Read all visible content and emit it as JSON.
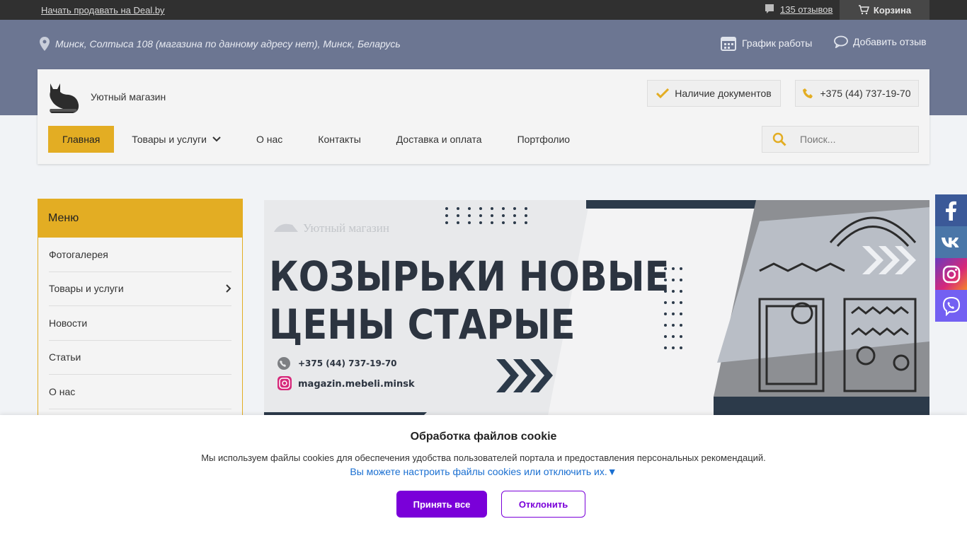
{
  "topbar": {
    "sell_link": "Начать продавать на Deal.by",
    "reviews": "135 отзывов",
    "cart": "Корзина"
  },
  "band": {
    "address": "Минск, Солтыса 108 (магазина по данному адресу нет), Минск, Беларусь",
    "schedule": "График работы",
    "add_review": "Добавить отзыв"
  },
  "header": {
    "shop_name": "Уютный магазин",
    "docs": "Наличие документов",
    "phone": "+375 (44) 737-19-70",
    "search_placeholder": "Поиск..."
  },
  "nav": {
    "items": [
      {
        "label": "Главная"
      },
      {
        "label": "Товары и услуги"
      },
      {
        "label": "О нас"
      },
      {
        "label": "Контакты"
      },
      {
        "label": "Доставка и оплата"
      },
      {
        "label": "Портфолио"
      }
    ]
  },
  "sidebar": {
    "title": "Меню",
    "items": [
      {
        "label": "Фотогалерея"
      },
      {
        "label": "Товары и услуги"
      },
      {
        "label": "Новости"
      },
      {
        "label": "Статьи"
      },
      {
        "label": "О нас"
      }
    ]
  },
  "banner": {
    "watermark": "Уютный магазин",
    "headline_1": "КОЗЫРЬКИ НОВЫЕ",
    "headline_2": "ЦЕНЫ СТАРЫЕ",
    "phone": "+375 (44) 737-19-70",
    "instagram": "magazin.mebeli.minsk"
  },
  "cookie": {
    "title": "Обработка файлов cookie",
    "text": "Мы используем файлы cookies для обеспечения удобства пользователей портала и предоставления персональных рекомендаций.",
    "link": "Вы можете настроить файлы cookies или отключить их.▼",
    "accept": "Принять все",
    "decline": "Отклонить"
  },
  "colors": {
    "accent": "#e3ad23",
    "band": "#6c7692",
    "cookie_button": "#7a00d9",
    "facebook": "#3b5998",
    "vk": "#4a76a8"
  },
  "icons": [
    "map-pin-icon",
    "calendar-icon",
    "chat-bubble-icon",
    "cart-icon",
    "checkmark-icon",
    "phone-icon",
    "search-icon",
    "chevron-down-icon",
    "chevron-right-icon",
    "facebook-icon",
    "vk-icon",
    "instagram-icon",
    "viber-icon",
    "cat-logo-icon"
  ]
}
